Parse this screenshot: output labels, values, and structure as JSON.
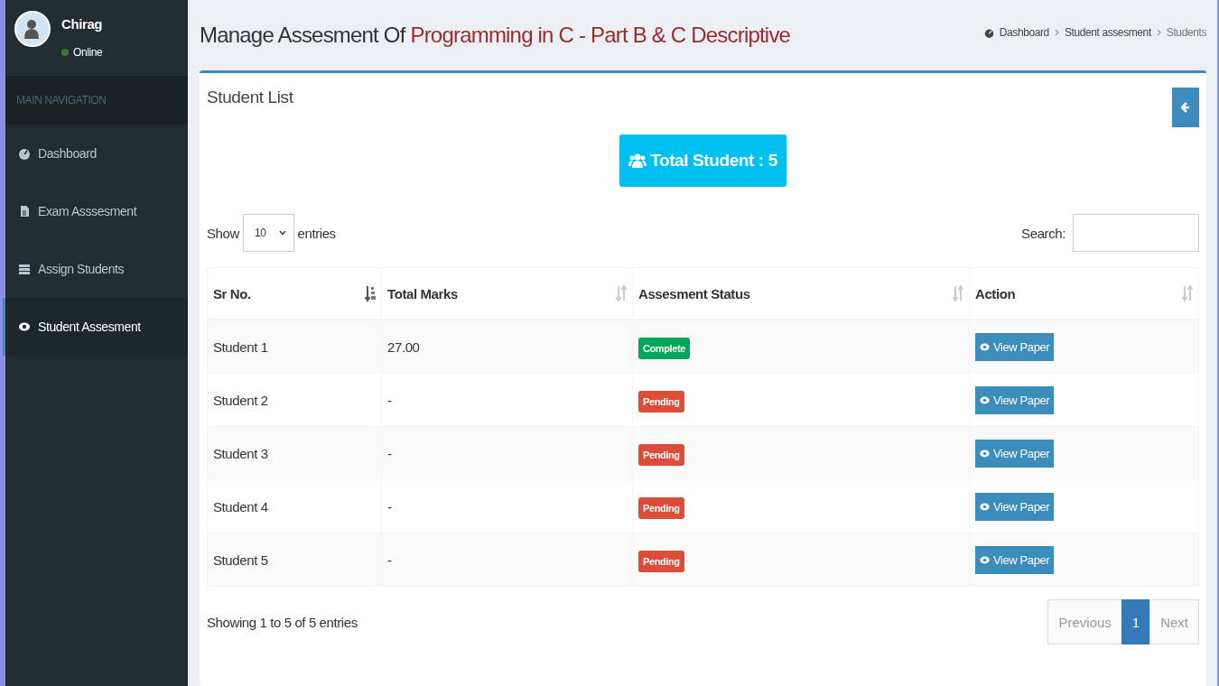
{
  "sidebar": {
    "user": {
      "name": "Chirag",
      "status": "Online"
    },
    "header": "MAIN NAVIGATION",
    "items": [
      {
        "label": "Dashboard",
        "selected": false
      },
      {
        "label": "Exam Asssesment",
        "selected": false
      },
      {
        "label": "Assign Students",
        "selected": false
      },
      {
        "label": "Student Assesment",
        "selected": true
      }
    ]
  },
  "page": {
    "title": "Manage Assesment Of",
    "subject": "Programming in C - Part B & C Descriptive",
    "breadcrumb": [
      "Dashboard",
      "Student assesment",
      "Students"
    ]
  },
  "box": {
    "title": "Student List",
    "total": "Total Student : 5",
    "length": {
      "before": "Show",
      "value": "10",
      "after": "entries"
    },
    "search_label": "Search:",
    "columns": [
      {
        "label": "Sr No.",
        "sorted": true
      },
      {
        "label": "Total Marks",
        "sorted": false
      },
      {
        "label": "Assesment Status",
        "sorted": false
      },
      {
        "label": "Action",
        "sorted": false
      }
    ],
    "rows": [
      {
        "name": "Student 1",
        "marks": "27.00",
        "status": "Complete",
        "kind": "complete",
        "action": "View Paper"
      },
      {
        "name": "Student 2",
        "marks": "-",
        "status": "Pending",
        "kind": "pending",
        "action": "View Paper"
      },
      {
        "name": "Student 3",
        "marks": "-",
        "status": "Pending",
        "kind": "pending",
        "action": "View Paper"
      },
      {
        "name": "Student 4",
        "marks": "-",
        "status": "Pending",
        "kind": "pending",
        "action": "View Paper"
      },
      {
        "name": "Student 5",
        "marks": "-",
        "status": "Pending",
        "kind": "pending",
        "action": "View Paper"
      }
    ],
    "info": "Showing 1 to 5 of 5 entries",
    "pagination": [
      {
        "label": "Previous",
        "selected": false,
        "disabled": true
      },
      {
        "label": "1",
        "selected": true,
        "disabled": false
      },
      {
        "label": "Next",
        "selected": false,
        "disabled": true
      }
    ]
  }
}
